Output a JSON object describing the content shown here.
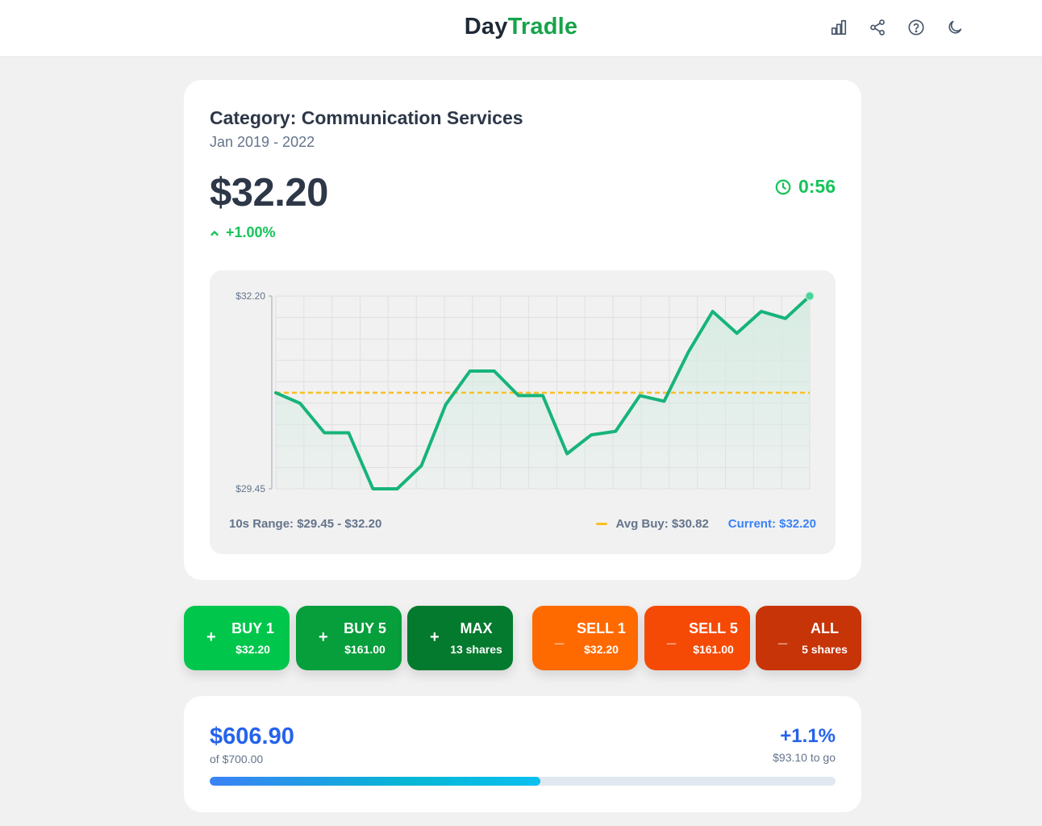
{
  "header": {
    "logo_part1": "Day",
    "logo_part2": "Tradle",
    "icons": [
      "stats-icon",
      "share-icon",
      "help-icon",
      "dark-mode-icon"
    ]
  },
  "game": {
    "category": "Category: Communication Services",
    "period": "Jan 2019 - 2022",
    "price": "$32.20",
    "change": "+1.00%",
    "timer": "0:56"
  },
  "chart_data": {
    "type": "line",
    "y_top_label": "$32.20",
    "y_bottom_label": "$29.45",
    "ylim": [
      29.45,
      32.2
    ],
    "values": [
      30.82,
      30.67,
      30.25,
      30.25,
      29.45,
      29.45,
      29.78,
      30.65,
      31.13,
      31.13,
      30.78,
      30.78,
      29.95,
      30.22,
      30.27,
      30.78,
      30.7,
      31.4,
      31.98,
      31.67,
      31.98,
      31.88,
      32.2
    ],
    "avg_buy": 30.82,
    "range_label": "10s Range: $29.45 - $32.20",
    "avg_label": "Avg Buy: $30.82",
    "current_label": "Current: $32.20",
    "colors": {
      "line": "#16b47a",
      "avg": "#fbbf24",
      "fill": "#d7ece3"
    }
  },
  "buttons": [
    {
      "sign": "+",
      "label": "BUY 1",
      "sub": "$32.20",
      "color": "#00c64c"
    },
    {
      "sign": "+",
      "label": "BUY 5",
      "sub": "$161.00",
      "color": "#079e3c"
    },
    {
      "sign": "+",
      "label": "MAX",
      "sub": "13 shares",
      "color": "#047a2e"
    },
    {
      "sign": "_",
      "label": "SELL 1",
      "sub": "$32.20",
      "color": "#ff6a00"
    },
    {
      "sign": "_",
      "label": "SELL 5",
      "sub": "$161.00",
      "color": "#f54a05"
    },
    {
      "sign": "_",
      "label": "ALL",
      "sub": "5 shares",
      "color": "#c73408"
    }
  ],
  "goal": {
    "value": "$606.90",
    "of": "of $700.00",
    "pct": "+1.1%",
    "to_go": "$93.10 to go",
    "progress": 0.528
  }
}
